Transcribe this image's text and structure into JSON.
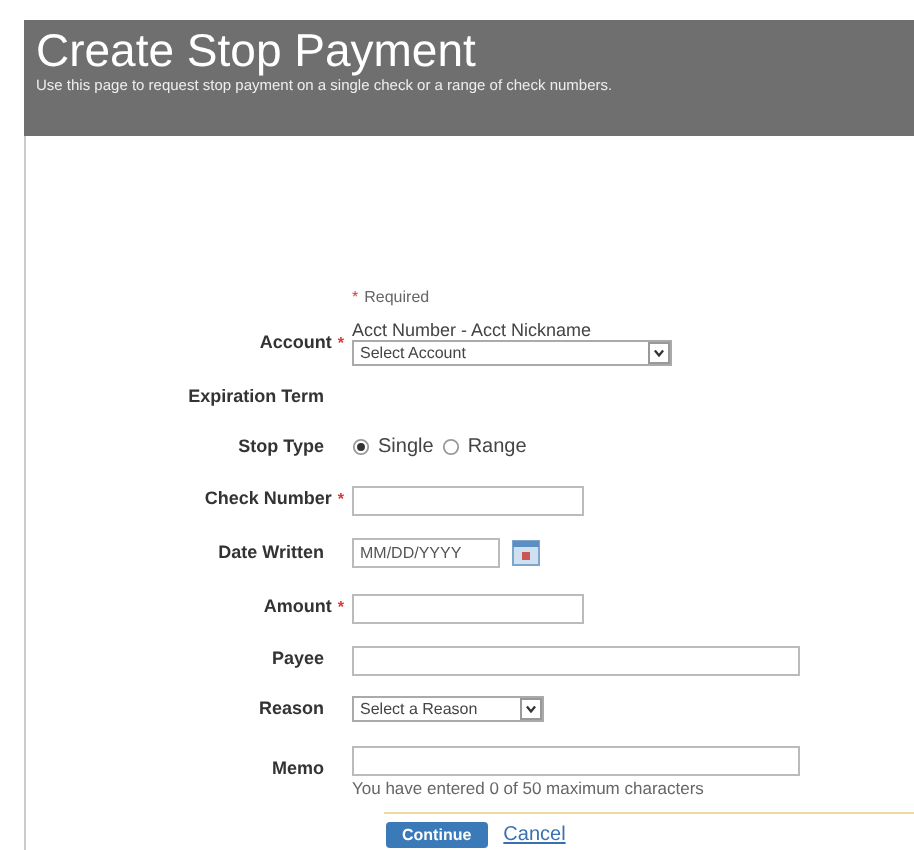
{
  "header": {
    "title": "Create Stop Payment",
    "subtitle": "Use this page to request stop payment on a single check or a range of check numbers."
  },
  "required_note": {
    "mark": "*",
    "text": "Required"
  },
  "fields": [
    {
      "kind": "select",
      "label": "Account",
      "required": true,
      "hint": "Acct Number - Acct Nickname",
      "value": "Select Account",
      "wide": true
    },
    {
      "kind": "none",
      "label": "Expiration Term",
      "required": false
    },
    {
      "kind": "radio",
      "label": "Stop Type",
      "required": false,
      "options": [
        {
          "label": "Single",
          "selected": true
        },
        {
          "label": "Range",
          "selected": false
        }
      ]
    },
    {
      "kind": "text",
      "label": "Check Number",
      "required": true,
      "wide": false
    },
    {
      "kind": "date",
      "label": "Date Written",
      "required": false,
      "placeholder": "MM/DD/YYYY"
    },
    {
      "kind": "text",
      "label": "Amount",
      "required": true,
      "wide": false
    },
    {
      "kind": "text",
      "label": "Payee",
      "required": false,
      "wide": true
    },
    {
      "kind": "select",
      "label": "Reason",
      "required": false,
      "value": "Select a Reason",
      "wide": false
    },
    {
      "kind": "text",
      "label": "Memo",
      "required": false,
      "wide": true,
      "note": "You have entered 0 of 50 maximum characters"
    }
  ],
  "actions": {
    "primary": "Continue",
    "secondary": "Cancel"
  }
}
